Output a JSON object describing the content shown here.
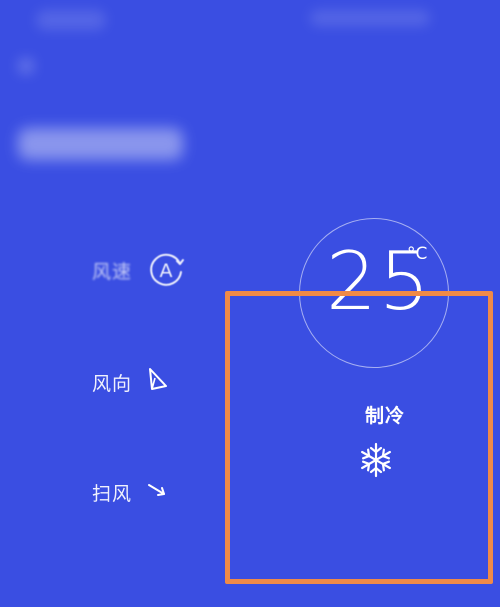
{
  "controls": {
    "fan_speed": {
      "label": "风速",
      "icon_char": "A",
      "icon": "auto-fan-icon"
    },
    "fan_direction": {
      "label": "风向",
      "icon": "direction-pointer-icon"
    },
    "sweep": {
      "label": "扫风",
      "icon": "sweep-arrow-icon"
    }
  },
  "temperature": {
    "value": "25",
    "unit": "°C"
  },
  "mode": {
    "label": "制冷",
    "icon": "snowflake-icon"
  },
  "colors": {
    "background": "#3a4ee2",
    "highlight": "#f08a47",
    "text": "#ffffff"
  }
}
